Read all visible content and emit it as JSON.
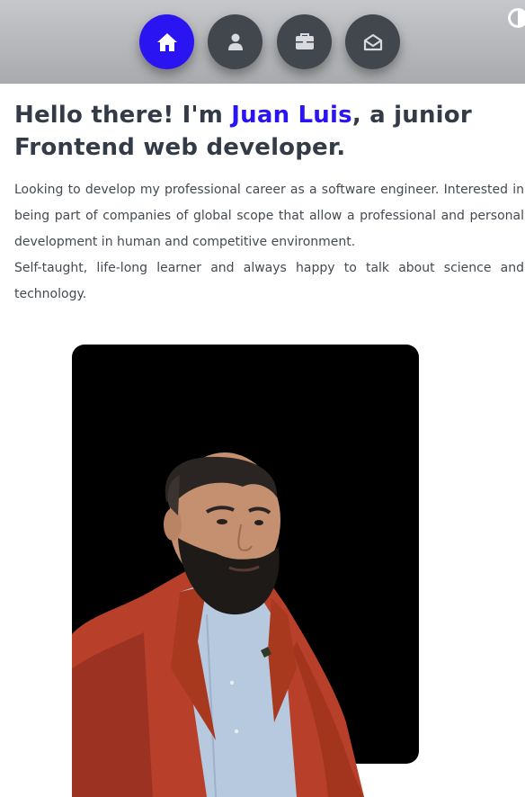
{
  "nav": {
    "items": [
      {
        "name": "home",
        "icon": "home-icon",
        "active": true
      },
      {
        "name": "about",
        "icon": "user-icon",
        "active": false
      },
      {
        "name": "portfolio",
        "icon": "briefcase-icon",
        "active": false
      },
      {
        "name": "contact",
        "icon": "envelope-open-icon",
        "active": false
      }
    ],
    "theme_toggle_icon": "half-circle-contrast-icon"
  },
  "hero": {
    "greeting_prefix": "Hello there! I'm ",
    "name": "Juan Luis",
    "greeting_suffix": ", a junior Frontend web developer.",
    "paragraph_1": "Looking to develop my professional career as a software engineer. Interested in being part of companies of global scope that allow a professional and personal development in human and competitive environment.",
    "paragraph_2": "Self-taught, life-long learner and always happy to talk about science and technology."
  },
  "colors": {
    "accent": "#2b14f2",
    "nav_button": "#42464d",
    "header_bg": "#b4b5b8",
    "text_dark": "#333b47",
    "jacket": "#b8402a"
  }
}
